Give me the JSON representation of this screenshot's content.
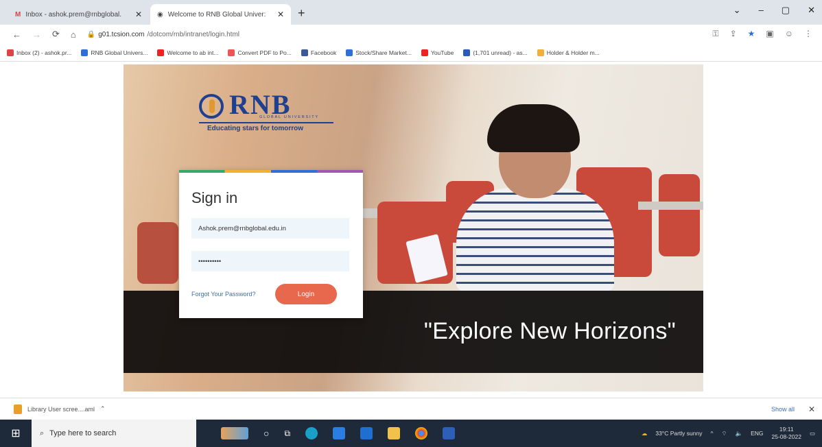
{
  "browser": {
    "tabs": [
      {
        "label": "Inbox - ashok.prem@rnbglobal.",
        "active": false
      },
      {
        "label": "Welcome to RNB Global Univer:",
        "active": true
      }
    ],
    "url_host": "g01.tcsion.com",
    "url_path": "/dotcom/rnb/intranet/login.html",
    "bookmarks": [
      "Inbox (2) - ashok.pr...",
      "RNB Global Univers...",
      "Welcome to ab int...",
      "Convert PDF to Po...",
      "Facebook",
      "Stock/Share Market...",
      "YouTube",
      "(1,701 unread) - as...",
      "Holder & Holder m..."
    ]
  },
  "logo": {
    "name": "RNB",
    "sub": "GLOBAL UNIVERSITY",
    "tagline": "Educating stars for tomorrow"
  },
  "signin": {
    "title": "Sign in",
    "email": "Ashok.prem@rnbglobal.edu.in",
    "password": "••••••••••",
    "forgot": "Forgot Your Password?",
    "login": "Login"
  },
  "banner": {
    "text": "\"Explore New Horizons\""
  },
  "downloads": {
    "item": "Library User scree....aml",
    "show_all": "Show all"
  },
  "taskbar": {
    "search": "Type here to search",
    "weather": "33°C Partly sunny",
    "lang": "ENG",
    "time": "19:11",
    "date": "25-08-2022"
  }
}
